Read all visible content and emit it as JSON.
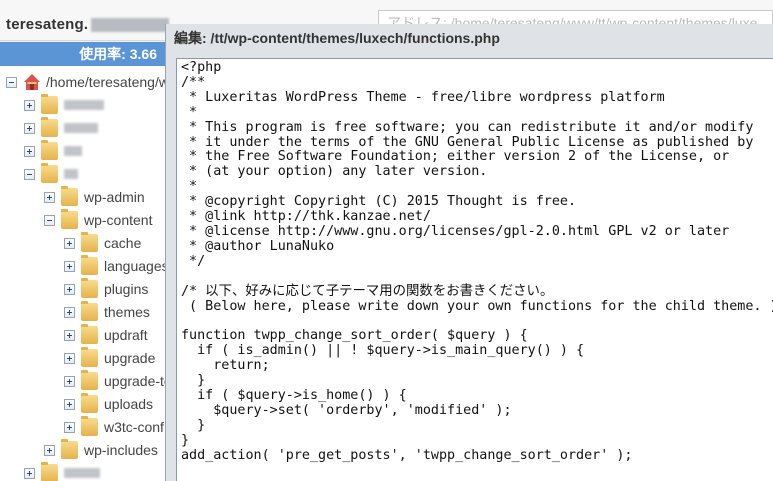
{
  "header": {
    "account": "teresateng.",
    "bg_path": "アドレス: /home/teresateng/www/tt/wp-content/themes/luxe"
  },
  "usage": {
    "label": "使用率: 3.66"
  },
  "tree": {
    "root": "/home/teresateng/w",
    "items": [
      {
        "label": "wp-admin"
      },
      {
        "label": "wp-content"
      },
      {
        "label": "cache"
      },
      {
        "label": "languages"
      },
      {
        "label": "plugins"
      },
      {
        "label": "themes"
      },
      {
        "label": "updraft"
      },
      {
        "label": "upgrade"
      },
      {
        "label": "upgrade-te"
      },
      {
        "label": "uploads"
      },
      {
        "label": "w3tc-conf"
      },
      {
        "label": "wp-includes"
      }
    ]
  },
  "editor": {
    "title": "編集: /tt/wp-content/themes/luxech/functions.php",
    "code": "<?php\n/**\n * Luxeritas WordPress Theme - free/libre wordpress platform\n *\n * This program is free software; you can redistribute it and/or modify\n * it under the terms of the GNU General Public License as published by\n * the Free Software Foundation; either version 2 of the License, or\n * (at your option) any later version.\n *\n * @copyright Copyright (C) 2015 Thought is free.\n * @link http://thk.kanzae.net/\n * @license http://www.gnu.org/licenses/gpl-2.0.html GPL v2 or later\n * @author LunaNuko\n */\n\n/* 以下、好みに応じて子テーマ用の関数をお書きください。\n ( Below here, please write down your own functions for the child theme. ) */\n\nfunction twpp_change_sort_order( $query ) {\n  if ( is_admin() || ! $query->is_main_query() ) {\n    return;\n  }\n  if ( $query->is_home() ) {\n    $query->set( 'orderby', 'modified' );\n  }\n}\nadd_action( 'pre_get_posts', 'twpp_change_sort_order' );"
  }
}
